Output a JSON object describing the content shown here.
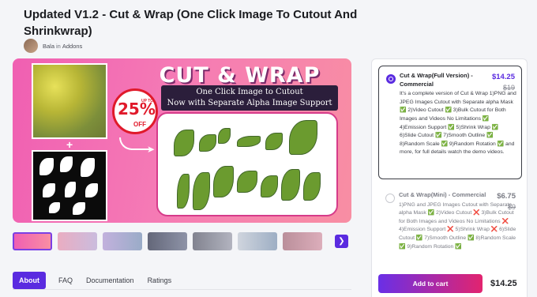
{
  "page": {
    "title": "Updated V1.2 - Cut & Wrap (One Click Image To Cutout And Shrinkwrap)",
    "author": "Bala",
    "in_text": "in",
    "category": "Addons"
  },
  "banner": {
    "headline": "CUT & WRAP V1.2",
    "subtitle_line1": "One Click Image to Cutout",
    "subtitle_line2": "Now with Separate Alpha Image Support",
    "badge_upto": "UP TO",
    "badge_pct": "25%",
    "badge_off": "OFF",
    "plus": "+"
  },
  "thumbnails": {
    "count": 7,
    "next_icon": "chevron-right-icon"
  },
  "tabs": [
    {
      "label": "About",
      "active": true
    },
    {
      "label": "FAQ",
      "active": false
    },
    {
      "label": "Documentation",
      "active": false
    },
    {
      "label": "Ratings",
      "active": false
    }
  ],
  "pricing": {
    "options": [
      {
        "name": "Cut & Wrap(Full Version) - Commercial",
        "price": "$14.25",
        "old_price": "$19",
        "selected": true,
        "desc": "It's a complete version of Cut & Wrap 1)PNG and JPEG Images Cutout with Separate alpha Mask ✅ 2)Video Cutout ✅ 3)Bulk Cutout for Both Images and Videos No Limitations ✅ 4)Emission Support ✅ 5)Shrink Wrap ✅ 6)Slide Cutout ✅ 7)Smooth Outline ✅ 8)Random Scale ✅ 9)Random Rotation ✅ and more, for full details watch the demo videos."
      },
      {
        "name": "Cut & Wrap(Mini) - Commercial",
        "price": "$6.75",
        "old_price": "$9",
        "selected": false,
        "desc": "1)PNG and JPEG Images Cutout with Separate alpha Mask ✅ 2)Video Cutout ❌ 3)Bulk Cutout for Both Images and Videos No Limitations ❌ 4)Emission Support ❌ 5)Shrink Wrap ❌ 6)Slide Cutout ✅ 7)Smooth Outline ✅ 8)Random Scale ✅ 9)Random Rotation ✅"
      }
    ],
    "cart_label": "Add to cart",
    "total": "$14.25"
  },
  "colors": {
    "accent": "#5a2be0",
    "banner_pink": "#f05fb2",
    "check_green": "#2bb043",
    "cross_red": "#e0283c"
  }
}
